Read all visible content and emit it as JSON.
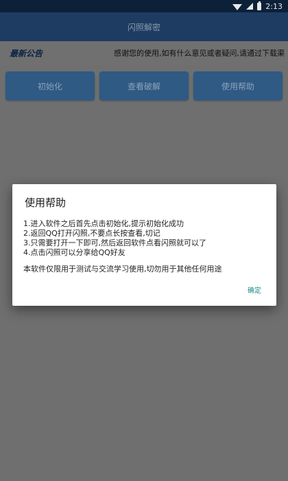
{
  "status_bar": {
    "time": "2:13",
    "icons": [
      "wifi-icon",
      "signal-icon",
      "battery-icon"
    ]
  },
  "app_bar": {
    "title": "闪照解密"
  },
  "notice": {
    "label": "最新公告",
    "text": "感谢您的使用,如有什么意见或者疑问,请通过下载渠"
  },
  "buttons": {
    "init": "初始化",
    "view": "查看破解",
    "help": "使用帮助"
  },
  "dialog": {
    "title": "使用帮助",
    "lines": [
      "1.进入软件之后首先点击初始化,提示初始化成功",
      "2.返回QQ打开闪照,不要点长按查看,切记",
      "3.只需要打开一下即可,然后返回软件点看闪照就可以了",
      "4.点击闪照可以分享给QQ好友"
    ],
    "note": "本软件仅限用于测试与交流学习使用,切勿用于其他任何用途",
    "ok": "确定"
  },
  "colors": {
    "status_bar": "#0c2038",
    "app_bar": "#1e3c62",
    "button": "#2e5a84",
    "background": "#6f6f6f",
    "dialog_ok": "#1f8a8a"
  }
}
